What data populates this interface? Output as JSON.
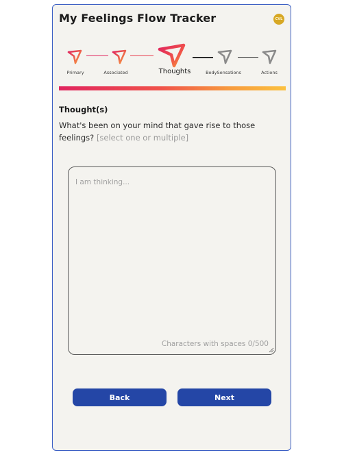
{
  "header": {
    "title": "My Feelings Flow Tracker",
    "badge": "CVL"
  },
  "stepper": {
    "steps": [
      {
        "label": "Primary",
        "state": "completed",
        "icon": "triangle-arrow-icon"
      },
      {
        "label": "Associated",
        "state": "completed",
        "icon": "triangle-arrow-icon"
      },
      {
        "label": "Thoughts",
        "state": "active",
        "icon": "triangle-arrow-icon"
      },
      {
        "label": "BodySensations",
        "state": "upcoming",
        "icon": "triangle-arrow-icon"
      },
      {
        "label": "Actions",
        "state": "upcoming",
        "icon": "triangle-arrow-icon"
      }
    ]
  },
  "section": {
    "title": "Thought(s)",
    "prompt": "What's been on your mind that gave rise to those feelings?",
    "hint": "[select one or multiple]"
  },
  "input": {
    "placeholder": "I am thinking...",
    "value": "",
    "counter": "Characters with spaces 0/500"
  },
  "buttons": {
    "back": "Back",
    "next": "Next"
  },
  "colors": {
    "accent": "#2446a6",
    "card_bg": "#f4f3ef",
    "card_border": "#3b5fc4",
    "gradient_start": "#e0245e",
    "gradient_end": "#fbc13f",
    "badge": "#d7a824",
    "inactive_icon": "#8a8a8a"
  }
}
